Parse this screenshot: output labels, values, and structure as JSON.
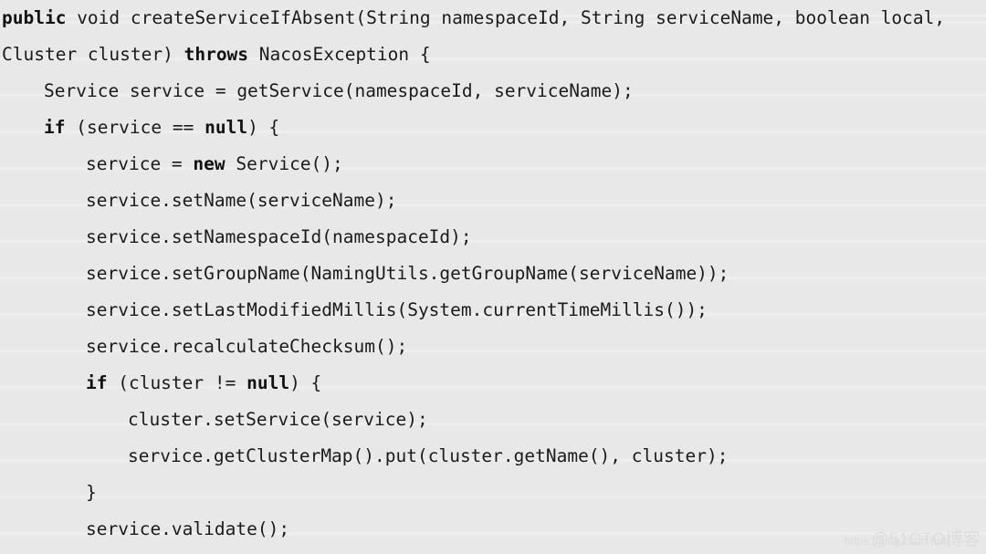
{
  "viewer": {
    "language": "java",
    "background_color": "#e8e8e8",
    "stripe_color": "#efeeee",
    "text_color": "#1b1b1b",
    "keyword_color": "#111111"
  },
  "code": {
    "lines": [
      {
        "indent": 0,
        "tokens": [
          {
            "text": "public",
            "keyword": true
          },
          {
            "text": " void createServiceIfAbsent(String namespaceId, String serviceName, boolean local,",
            "keyword": false
          }
        ]
      },
      {
        "indent": 0,
        "tokens": [
          {
            "text": "Cluster cluster) ",
            "keyword": false
          },
          {
            "text": "throws",
            "keyword": true
          },
          {
            "text": " NacosException {",
            "keyword": false
          }
        ]
      },
      {
        "indent": 1,
        "tokens": [
          {
            "text": "Service service = getService(namespaceId, serviceName);",
            "keyword": false
          }
        ]
      },
      {
        "indent": 1,
        "tokens": [
          {
            "text": "if",
            "keyword": true
          },
          {
            "text": " (service == ",
            "keyword": false
          },
          {
            "text": "null",
            "keyword": true
          },
          {
            "text": ") {",
            "keyword": false
          }
        ]
      },
      {
        "indent": 2,
        "tokens": [
          {
            "text": "service = ",
            "keyword": false
          },
          {
            "text": "new",
            "keyword": true
          },
          {
            "text": " Service();",
            "keyword": false
          }
        ]
      },
      {
        "indent": 2,
        "tokens": [
          {
            "text": "service.setName(serviceName);",
            "keyword": false
          }
        ]
      },
      {
        "indent": 2,
        "tokens": [
          {
            "text": "service.setNamespaceId(namespaceId);",
            "keyword": false
          }
        ]
      },
      {
        "indent": 2,
        "tokens": [
          {
            "text": "service.setGroupName(NamingUtils.getGroupName(serviceName));",
            "keyword": false
          }
        ]
      },
      {
        "indent": 2,
        "tokens": [
          {
            "text": "service.setLastModifiedMillis(System.currentTimeMillis());",
            "keyword": false
          }
        ]
      },
      {
        "indent": 2,
        "tokens": [
          {
            "text": "service.recalculateChecksum();",
            "keyword": false
          }
        ]
      },
      {
        "indent": 2,
        "tokens": [
          {
            "text": "if",
            "keyword": true
          },
          {
            "text": " (cluster != ",
            "keyword": false
          },
          {
            "text": "null",
            "keyword": true
          },
          {
            "text": ") {",
            "keyword": false
          }
        ]
      },
      {
        "indent": 3,
        "tokens": [
          {
            "text": "cluster.setService(service);",
            "keyword": false
          }
        ]
      },
      {
        "indent": 3,
        "tokens": [
          {
            "text": "service.getClusterMap().put(cluster.getName(), cluster);",
            "keyword": false
          }
        ]
      },
      {
        "indent": 2,
        "tokens": [
          {
            "text": "}",
            "keyword": false
          }
        ]
      },
      {
        "indent": 2,
        "tokens": [
          {
            "text": "service.validate();",
            "keyword": false
          }
        ]
      }
    ]
  },
  "watermark": {
    "brand": "@51CTO博客",
    "url": "https://blog.csdn.net/"
  }
}
